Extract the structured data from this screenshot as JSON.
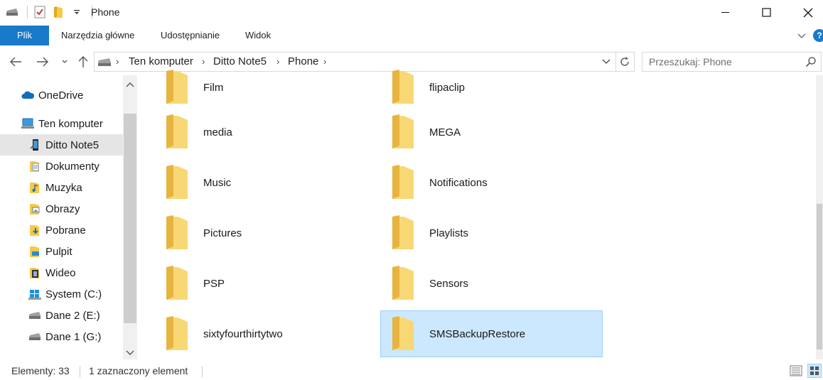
{
  "window": {
    "title": "Phone"
  },
  "ribbon": {
    "tabs": [
      {
        "label": "Plik"
      },
      {
        "label": "Narzędzia główne"
      },
      {
        "label": "Udostępnianie"
      },
      {
        "label": "Widok"
      }
    ],
    "accent": "#1979ca"
  },
  "address": {
    "crumbs": [
      "Ten komputer",
      "Ditto Note5",
      "Phone"
    ]
  },
  "search": {
    "placeholder": "Przeszukaj: Phone"
  },
  "nav": {
    "items": [
      {
        "label": "OneDrive",
        "icon": "cloud-icon"
      },
      {
        "label": "Ten komputer",
        "icon": "computer-icon"
      },
      {
        "label": "Ditto Note5",
        "icon": "phone-icon",
        "selected": true
      },
      {
        "label": "Dokumenty",
        "icon": "documents-icon"
      },
      {
        "label": "Muzyka",
        "icon": "music-icon"
      },
      {
        "label": "Obrazy",
        "icon": "pictures-icon"
      },
      {
        "label": "Pobrane",
        "icon": "downloads-icon"
      },
      {
        "label": "Pulpit",
        "icon": "desktop-icon"
      },
      {
        "label": "Wideo",
        "icon": "video-icon"
      },
      {
        "label": "System (C:)",
        "icon": "windows-drive-icon"
      },
      {
        "label": "Dane 2 (E:)",
        "icon": "drive-icon"
      },
      {
        "label": "Dane 1 (G:)",
        "icon": "drive-icon"
      }
    ]
  },
  "content": {
    "folders": [
      {
        "name": "Film"
      },
      {
        "name": "flipaclip"
      },
      {
        "name": "media"
      },
      {
        "name": "MEGA"
      },
      {
        "name": "Music"
      },
      {
        "name": "Notifications"
      },
      {
        "name": "Pictures"
      },
      {
        "name": "Playlists"
      },
      {
        "name": "PSP"
      },
      {
        "name": "Sensors"
      },
      {
        "name": "sixtyfourthirtytwo"
      },
      {
        "name": "SMSBackupRestore",
        "selected": true
      }
    ]
  },
  "status": {
    "count": "Elementy: 33",
    "selection": "1 zaznaczony element"
  }
}
